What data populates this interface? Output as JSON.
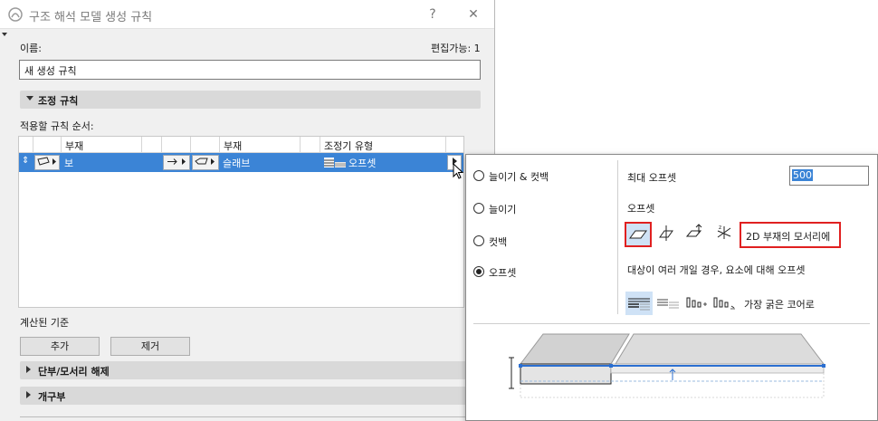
{
  "dialog": {
    "title": "구조 해석 모델 생성 규칙",
    "help": "?",
    "close": "✕",
    "name_label": "이름:",
    "editable_label": "편집가능: 1",
    "name_value": "새 생성 규칙",
    "adjust_section": "조정 규칙",
    "order_label": "적용할 규칙 순서:",
    "columns": [
      "부재",
      "부재",
      "조정기 유형"
    ],
    "row": {
      "member1": "보",
      "member2": "슬래브",
      "adjuster": "오프셋"
    },
    "computed_label": "계산된 기준",
    "add_button": "추가",
    "remove_button": "제거",
    "section_end": "단부/모서리 해제",
    "section_opening": "개구부"
  },
  "popover": {
    "options": [
      "늘이기 & 컷백",
      "늘이기",
      "컷백",
      "오프셋"
    ],
    "selected": "오프셋",
    "max_offset_label": "최대 오프셋",
    "max_offset_value": "500",
    "offset_label": "오프셋",
    "offset_target": "2D 부재의 모서리에",
    "multi_label": "대상이 여러 개일 경우, 요소에 대해 오프셋",
    "core_label": "가장 굵은 코어로"
  },
  "colors": {
    "selection": "#3b84d6",
    "highlight": "#e02020"
  }
}
